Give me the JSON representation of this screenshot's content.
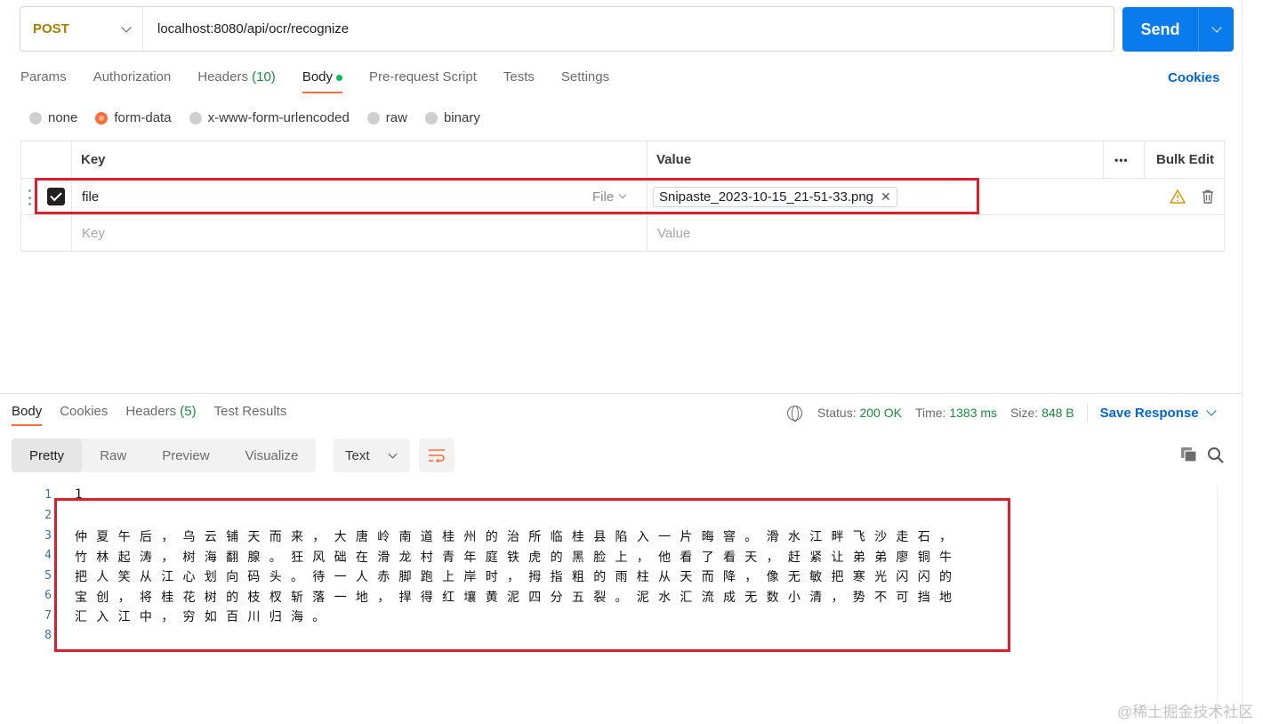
{
  "request": {
    "method": "POST",
    "url": "localhost:8080/api/ocr/recognize",
    "send_label": "Send"
  },
  "req_tabs": {
    "params": "Params",
    "authorization": "Authorization",
    "headers": "Headers",
    "headers_count": "(10)",
    "body": "Body",
    "prerequest": "Pre-request Script",
    "tests": "Tests",
    "settings": "Settings",
    "cookies": "Cookies"
  },
  "body_types": {
    "none": "none",
    "form_data": "form-data",
    "urlencoded": "x-www-form-urlencoded",
    "raw": "raw",
    "binary": "binary",
    "selected": "form-data"
  },
  "params_table": {
    "key_header": "Key",
    "value_header": "Value",
    "more": "•••",
    "bulk_edit": "Bulk Edit",
    "row": {
      "key": "file",
      "type": "File",
      "value": "Snipaste_2023-10-15_21-51-33.png",
      "remove": "✕",
      "checked": true
    },
    "key_placeholder": "Key",
    "value_placeholder": "Value"
  },
  "response": {
    "tabs": {
      "body": "Body",
      "cookies": "Cookies",
      "headers": "Headers",
      "headers_count": "(5)",
      "test_results": "Test Results"
    },
    "status_label": "Status:",
    "status_value": "200 OK",
    "time_label": "Time:",
    "time_value": "1383 ms",
    "size_label": "Size:",
    "size_value": "848 B",
    "save_response": "Save Response",
    "views": {
      "pretty": "Pretty",
      "raw": "Raw",
      "preview": "Preview",
      "visualize": "Visualize"
    },
    "format": "Text",
    "lines": [
      {
        "n": "1",
        "t": "1"
      },
      {
        "n": "2",
        "t": ""
      },
      {
        "n": "3",
        "t": "仲夏午后，乌云铺天而来，大唐岭南道桂州的治所临桂县陷入一片晦窨。滑水江畔飞沙走石，"
      },
      {
        "n": "4",
        "t": "竹林起涛，树海翻腺。狂风础在滑龙村青年庭铁虎的黑脸上，他看了看天，赶紧让弟弟廖铜牛"
      },
      {
        "n": "5",
        "t": "把人笑从江心划向码头。待一人赤脚跑上岸时，拇指粗的雨柱从天而降，像无敏把寒光闪闪的"
      },
      {
        "n": "6",
        "t": "宝创，将桂花树的枝杈斩落一地，捍得红壤黄泥四分五裂。泥水汇流成无数小清，势不可挡地"
      },
      {
        "n": "7",
        "t": "汇入江中，穷如百川归海。"
      },
      {
        "n": "8",
        "t": ""
      }
    ]
  },
  "watermark": "@稀土掘金技术社区",
  "colors": {
    "accent": "#ff6c37",
    "send": "#097bed",
    "link": "#0265d2",
    "status_ok": "#1a8a3d",
    "highlight_box": "#d9202f"
  }
}
